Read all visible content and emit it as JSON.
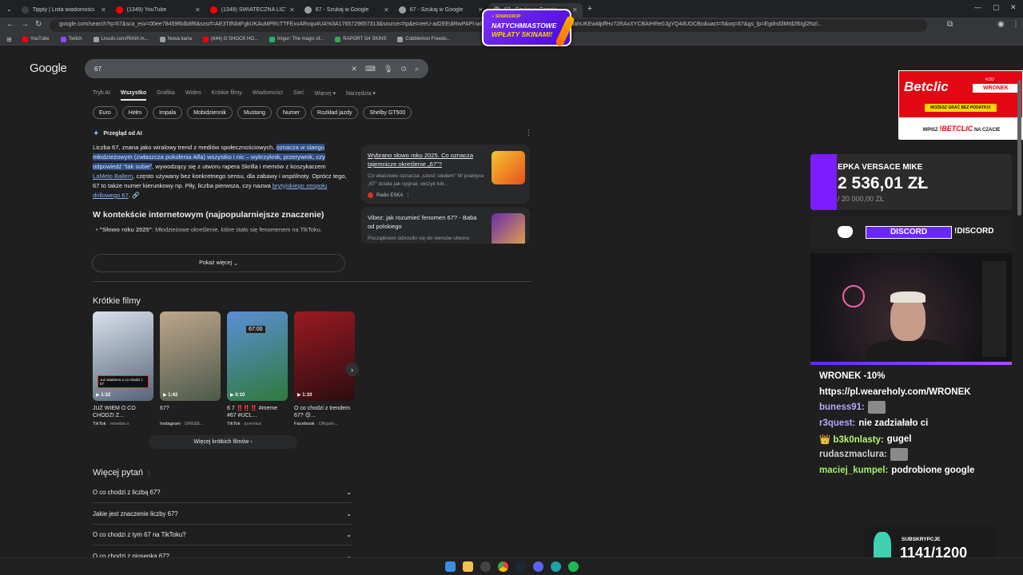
{
  "browser": {
    "tabs": [
      {
        "title": "Tipply | Lista wiadomości",
        "color": "#3c4043"
      },
      {
        "title": "(1349) YouTube",
        "color": "#ff0000"
      },
      {
        "title": "(1349) ŚWIATECZNA LICYTACJA",
        "color": "#ff0000"
      },
      {
        "title": "67 - Szukaj w Google",
        "color": "#9aa0a6"
      },
      {
        "title": "67 - Szukaj w Google",
        "color": "#9aa0a6"
      },
      {
        "title": "67 - Szukaj w Google",
        "color": "#9aa0a6"
      }
    ],
    "new_tab": "+",
    "url": "google.com/search?q=67&sca_esv=00ee78459f6db8f6&sxsrf=AE3TifNbtFgkUKAuMPRcTTFExvARvqu4UA%3A1765729657313&source=hp&ei=eeU-ad2EEdiRwPAPl-iaMQ...RVsBENVTcQSuxQeRG&ved=0ahUKEwidpffHv72RAxXYCBAIHRe0JgYQ4dUDCBo&uact=5&oq=67&gs_lp=Egdnd3Mtd2l6Igl2Nzl...",
    "bookmarks": [
      {
        "label": "YouTube",
        "color": "#ff0000"
      },
      {
        "label": "Twitch",
        "color": "#9146ff"
      },
      {
        "label": "Lnuuls.com/RrhiX.m...",
        "color": "#9aa0a6"
      },
      {
        "label": "Nowa karta",
        "color": "#9aa0a6"
      },
      {
        "label": "(644) G SHOCK HO...",
        "color": "#ff0000"
      },
      {
        "label": "Imgur: The magic of...",
        "color": "#1bb76e"
      },
      {
        "label": "RAPORT G4 SKINS",
        "color": "#34a853"
      },
      {
        "label": "Cobblemon Freedo...",
        "color": "#9aa0a6"
      }
    ]
  },
  "google": {
    "logo": "Google",
    "query": "67",
    "tabs": [
      "Tryb AI",
      "Wszystko",
      "Grafika",
      "Wideo",
      "Krótkie filmy",
      "Wiadomości",
      "Sieć",
      "Więcej ▾",
      "Narzędzia ▾"
    ],
    "chips": [
      "Euro",
      "Hełm",
      "Impala",
      "Mobidziennik",
      "Mustang",
      "Numer",
      "Rozkład jazdy",
      "Shelby GT500"
    ],
    "ai": {
      "heading": "Przegląd od AI",
      "p_a": "Liczba 67, znana jako wiralowy trend z mediów społecznościowych, ",
      "p_hl": "oznacza w slangu młodzieżowym (zwłaszcza pokolenia Alfa) wszystko i nic – wykrzyknik, przerywnik, czy odpowiedź \"tak sobie\"",
      "p_b": ", wywodzący się z utworu rapera Skrilla i memów z koszykarzem ",
      "p_link1": "LaMelo Ballem",
      "p_c": ", często używany bez konkretnego sensu, dla zabawy i wspólnoty. Oprócz tego, 67 to także numer kierunkowy np. Piły, liczba pierwsza, czy nazwa ",
      "p_link2": "brytyjskiego zespołu drillowego 67",
      "p_d": ".",
      "subheading": "W kontekście internetowym (najpopularniejsze znaczenie)",
      "bullet_bold": "\"Słowo roku 2025\"",
      "bullet_text": ": Młodzieżowe określenie, które stało się fenomenem na TikToku.",
      "show_more": "Pokaż więcej",
      "sources": [
        {
          "title": "Wybrano słowo roku 2025. Co oznacza tajemnicze określenie „67\"?",
          "desc": "Co właściwie oznacza „sześć siedem\" W praktyce „67\" działa jak sygnał, okrzyk lub...",
          "site": "Radio ESKA"
        },
        {
          "title": "Vibez: jak rozumieć fenomen 67? - Baba od polskiego",
          "desc": "Początkowo odnosiło się do wersów utworu",
          "site": ""
        }
      ]
    },
    "shorts": {
      "title": "Krótkie filmy",
      "items": [
        {
          "duration": "▶ 1:32",
          "caption": "JUŻ WIEM O CO CHODZI Z...",
          "platform": "TikTok",
          "author": "mondar.x",
          "overlay": "Już wiadomo o co chodzi z 67"
        },
        {
          "duration": "▶ 1:42",
          "caption": "67?",
          "platform": "Instagram",
          "author": "DRE$$...",
          "overlay": ""
        },
        {
          "duration": "▶ 0:10",
          "caption": "6 7 ‼️‼️‼️ #meme #67 #UCL...",
          "platform": "TikTok",
          "author": "juventus",
          "overlay": "67:00"
        },
        {
          "duration": "▶ 1:10",
          "caption": "O co chodzi z trendem 67? 😊...",
          "platform": "Facebook",
          "author": "Oficjaln...",
          "overlay": ""
        }
      ],
      "more": "Więcej krótkich filmów"
    },
    "faq": {
      "title": "Więcej pytań",
      "items": [
        "O co chodzi z liczbą 67?",
        "Jakie jest znaczenie liczby 67?",
        "O co chodzi z tym 67 na TikToku?",
        "O co chodzi z piosenką 67?"
      ]
    }
  },
  "overlay": {
    "promo_top": "⚡ SPARKDROP",
    "promo_line1": "NATYCHMIASTOWE",
    "promo_line2": "WPŁATY SKINAMI!",
    "betclic": {
      "brand": "Betclic",
      "kod_label": "KOD",
      "code": "WRONEK",
      "tagline": "MOŻESZ GRAĆ BEZ PODATKU!",
      "cta_pre": "WPISZ",
      "cta_code": "!BETCLIC",
      "cta_post": "NA CZACIE"
    },
    "donation": {
      "name": "EPKA VERSACE MIKE",
      "amount": "2 536,01 ZŁ",
      "goal": "/ 20 000,00 ZŁ"
    },
    "discord": {
      "button": "DISCORD",
      "command": "!DISCORD"
    },
    "chat": [
      {
        "user": "WRONEK -10%",
        "text": "",
        "color": "#ffffff",
        "emote": false
      },
      {
        "user": "https://pl.weareholy.com/WRONEK",
        "text": "",
        "color": "#ffffff",
        "emote": false
      },
      {
        "user": "buness91:",
        "text": "",
        "color": "#b9a7ff",
        "emote": true
      },
      {
        "user": "r3quest:",
        "text": "nie zadziałało ci",
        "color": "#b9a7ff",
        "emote": false
      },
      {
        "user": "👑 b3k0nlasty:",
        "text": "gugel",
        "color": "#b7f56d",
        "emote": false
      },
      {
        "user": "rudaszmaclura:",
        "text": "",
        "color": "#cfcfcf",
        "emote": true
      },
      {
        "user": "maciej_kumpel:",
        "text": "podrobione google",
        "color": "#9ef26a",
        "emote": false
      }
    ],
    "subs": {
      "label": "SUBSKRYPCJE",
      "count": "1141/1200"
    }
  }
}
